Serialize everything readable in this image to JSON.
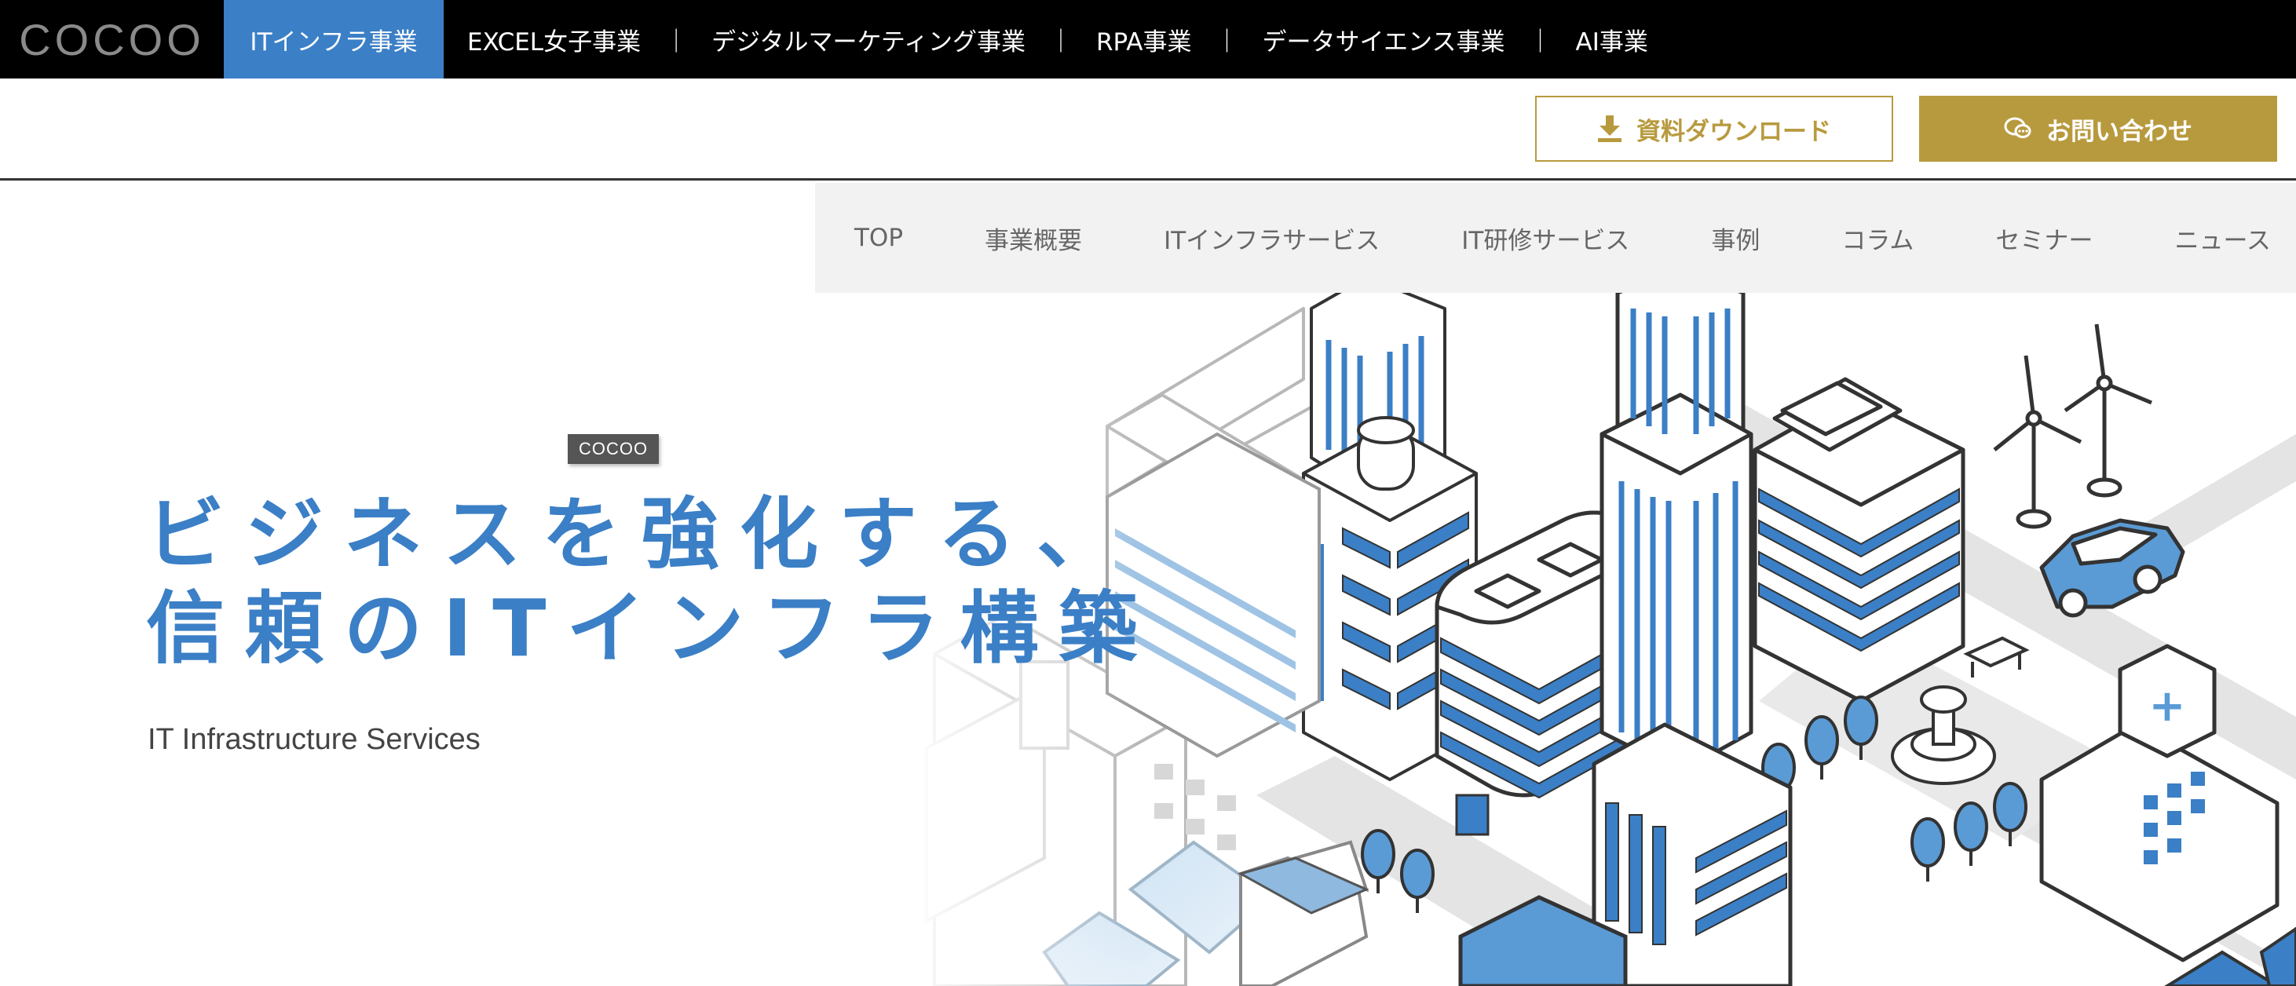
{
  "topbar": {
    "logo": "COCOO",
    "tabs": [
      {
        "label": "ITインフラ事業",
        "active": true
      },
      {
        "label": "EXCEL女子事業"
      },
      {
        "label": "デジタルマーケティング事業"
      },
      {
        "label": "RPA事業"
      },
      {
        "label": "データサイエンス事業"
      },
      {
        "label": "AI事業"
      }
    ],
    "separator": "｜"
  },
  "actions": {
    "download_label": "資料ダウンロード",
    "download_icon": "download-icon",
    "contact_label": "お問い合わせ",
    "contact_icon": "chat-bubble-icon"
  },
  "subnav": {
    "items": [
      "TOP",
      "事業概要",
      "ITインフラサービス",
      "IT研修サービス",
      "事例",
      "コラム",
      "セミナー",
      "ニュース"
    ]
  },
  "hero": {
    "badge": "COCOO",
    "headline_line1": "ビジネスを強化する、",
    "headline_line2": "信頼のITインフラ構築",
    "subtitle": "IT Infrastructure Services"
  },
  "colors": {
    "accent_blue": "#3b7fc6",
    "gold": "#b89a3e",
    "topbar_bg": "#000000",
    "subnav_bg": "#f2f2f2"
  }
}
